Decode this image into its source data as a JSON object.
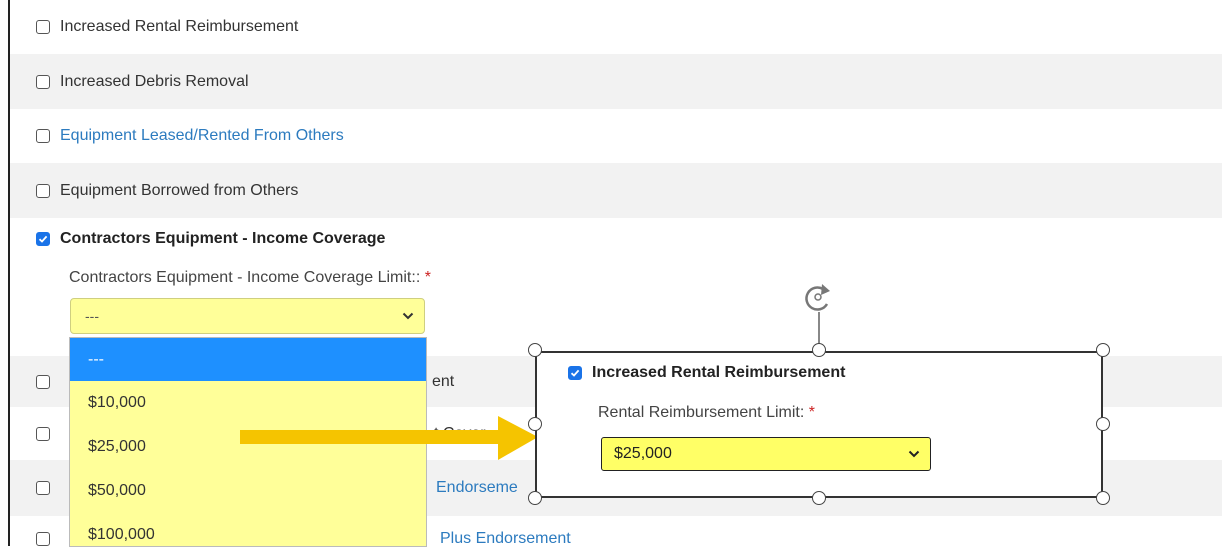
{
  "rows": {
    "increased_rental": "Increased Rental Reimbursement",
    "increased_debris": "Increased Debris Removal",
    "equipment_leased": "Equipment Leased/Rented From Others",
    "equipment_borrowed": "Equipment Borrowed from Others",
    "contractors_income": "Contractors Equipment - Income Coverage",
    "partial_row_1": "ent",
    "partial_row_2": "t Cover",
    "partial_row_3": "Endorseme",
    "partial_row_4": "Plus Endorsement"
  },
  "income_limit": {
    "label": "Contractors Equipment - Income Coverage Limit::",
    "required_mark": "*",
    "selected": "---",
    "options": [
      "---",
      "$10,000",
      "$25,000",
      "$50,000",
      "$100,000"
    ]
  },
  "callout": {
    "checkbox_label": "Increased Rental Reimbursement",
    "limit_label": "Rental Reimbursement Limit:",
    "required_mark": "*",
    "selected": "$25,000"
  },
  "colors": {
    "link": "#2c7bbf",
    "select_bg": "#ffff99",
    "highlight": "#1e90ff",
    "checkbox": "#1a73e8",
    "arrow": "#f5c400"
  },
  "icons": {
    "checkbox": "checkbox-icon",
    "checked_checkbox": "checkbox-checked-icon",
    "dropdown": "chevron-down-icon",
    "rotate": "rotate-icon",
    "arrow": "arrow-right-icon"
  }
}
